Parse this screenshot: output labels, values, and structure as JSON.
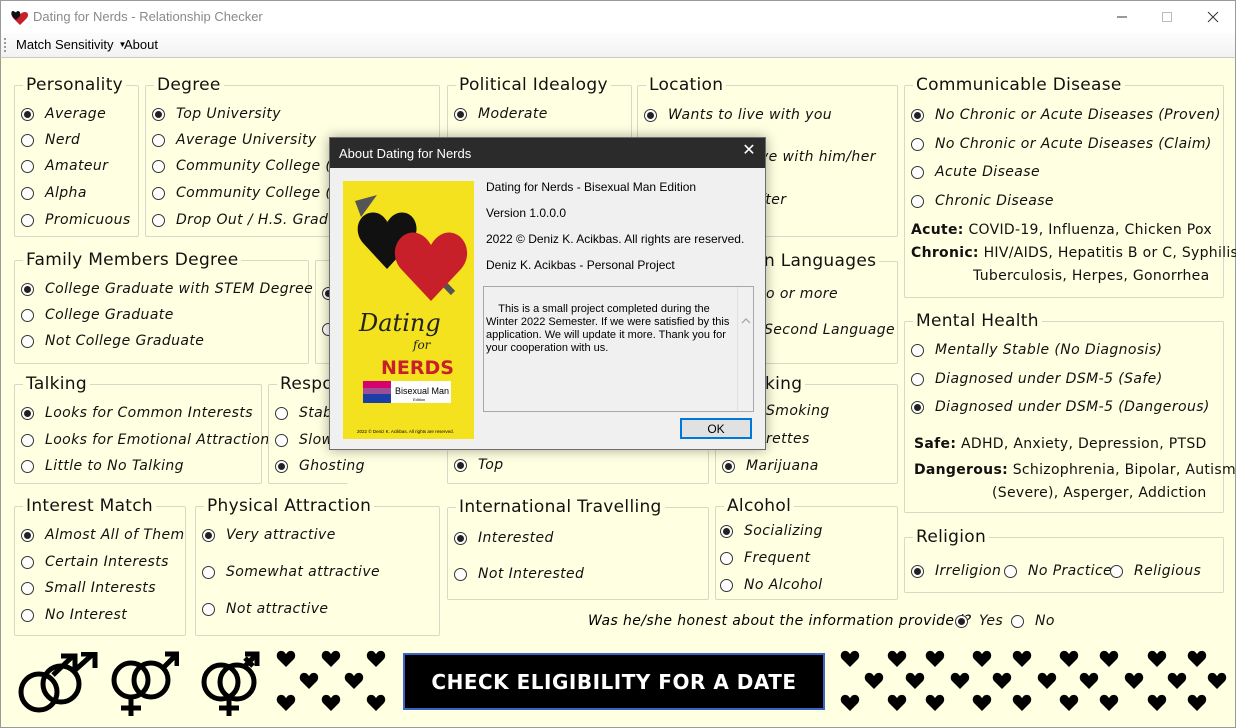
{
  "window": {
    "title": "Dating for Nerds - Relationship Checker"
  },
  "menu": {
    "match_sensitivity": "Match Sensitivity",
    "about": "About"
  },
  "groups": {
    "personality": {
      "title": "Personality",
      "options": [
        "Average",
        "Nerd",
        "Amateur",
        "Alpha",
        "Promicuous"
      ],
      "selected": 0
    },
    "degree": {
      "title": "Degree",
      "options": [
        "Top University",
        "Average University",
        "Community College (Wit",
        "Community College (Wit",
        "Drop Out / H.S. Graduat"
      ],
      "selected": 0
    },
    "political": {
      "title": "Political Idealogy",
      "options": [
        "Moderate"
      ],
      "selected": 0
    },
    "location": {
      "title": "Location",
      "options": [
        "Wants to live with you",
        "ve with him/her",
        "fter"
      ],
      "selected": 0
    },
    "communicable": {
      "title": "Communicable Disease",
      "options": [
        "No Chronic or Acute Diseases (Proven)",
        "No Chronic or Acute Diseases (Claim)",
        "Acute Disease",
        "Chronic Disease"
      ],
      "selected": 0,
      "acute_label": "Acute:",
      "acute_text": "COVID-19, Influenza, Chicken Pox",
      "chronic_label": "Chronic:",
      "chronic_text1": "HIV/AIDS, Hepatitis B or C, Syphilis",
      "chronic_text2": "Tuberculosis, Herpes, Gonorrhea"
    },
    "family": {
      "title": "Family Members Degree",
      "options": [
        "College Graduate with STEM Degree",
        "College Graduate",
        "Not College Graduate"
      ],
      "selected": 0
    },
    "languages": {
      "title": "n Languages",
      "options": [
        "o or more",
        "Second Language"
      ]
    },
    "mental": {
      "title": "Mental Health",
      "options": [
        "Mentally Stable (No Diagnosis)",
        "Diagnosed under DSM-5 (Safe)",
        "Diagnosed under DSM-5 (Dangerous)"
      ],
      "selected": 2,
      "safe_label": "Safe:",
      "safe_text": "ADHD, Anxiety, Depression, PTSD",
      "dangerous_label": "Dangerous:",
      "dangerous_text1": "Schizophrenia, Bipolar, Autism",
      "dangerous_text2": "(Severe), Asperger, Addiction"
    },
    "talking": {
      "title": "Talking",
      "options": [
        "Looks for Common Interests",
        "Looks for Emotional Attraction",
        "Little to No Talking"
      ],
      "selected": 0
    },
    "response": {
      "title": "Respon",
      "options": [
        "Stabl",
        "Slow",
        "Ghosting"
      ],
      "selected": 2
    },
    "income": {
      "options": [
        "Top"
      ],
      "selected": 0
    },
    "smoking": {
      "title": "king",
      "options": [
        "Smoking",
        "rettes",
        "Marijuana"
      ],
      "selected": 2
    },
    "religion": {
      "title": "Religion",
      "options": [
        "Irreligion",
        "No Practice",
        "Religious"
      ],
      "selected": 0
    },
    "interest": {
      "title": "Interest Match",
      "options": [
        "Almost All of Them",
        "Certain Interests",
        "Small Interests",
        "No Interest"
      ],
      "selected": 0
    },
    "physical": {
      "title": "Physical Attraction",
      "options": [
        "Very attractive",
        "Somewhat attractive",
        "Not attractive"
      ],
      "selected": 0
    },
    "travel": {
      "title": "International Travelling",
      "options": [
        "Interested",
        "Not Interested"
      ],
      "selected": 0
    },
    "alcohol": {
      "title": "Alcohol",
      "options": [
        "Socializing",
        "Frequent",
        "No Alcohol"
      ],
      "selected": 0
    }
  },
  "honesty": {
    "question": "Was he/she honest about the information provided?",
    "yes": "Yes",
    "no": "No",
    "selected": "yes"
  },
  "check_button": "CHECK ELIGIBILITY FOR A DATE",
  "about_dialog": {
    "title": "About Dating for Nerds",
    "product": "Dating for Nerds - Bisexual Man Edition",
    "version": "Version 1.0.0.0",
    "copyright": "2022 © Deniz K. Acikbas. All rights are reserved.",
    "company": "Deniz K. Acikbas - Personal Project",
    "description": "This is a small project completed during the Winter 2022 Semester. If we were satisfied by this application. We will update it more. Thank you for your cooperation with us.",
    "ok": "OK",
    "logo_dating": "Dating",
    "logo_for": "for",
    "logo_nerds": "NERDS",
    "logo_edition": "Bisexual Man",
    "logo_edition_small": "Edition",
    "logo_footer": "2022 © Deniz K. Acikbas. All rights are reserved."
  },
  "colors": {
    "background": "#ffffe1",
    "heart_red": "#c8202b",
    "logo_yellow": "#f3e21d"
  }
}
